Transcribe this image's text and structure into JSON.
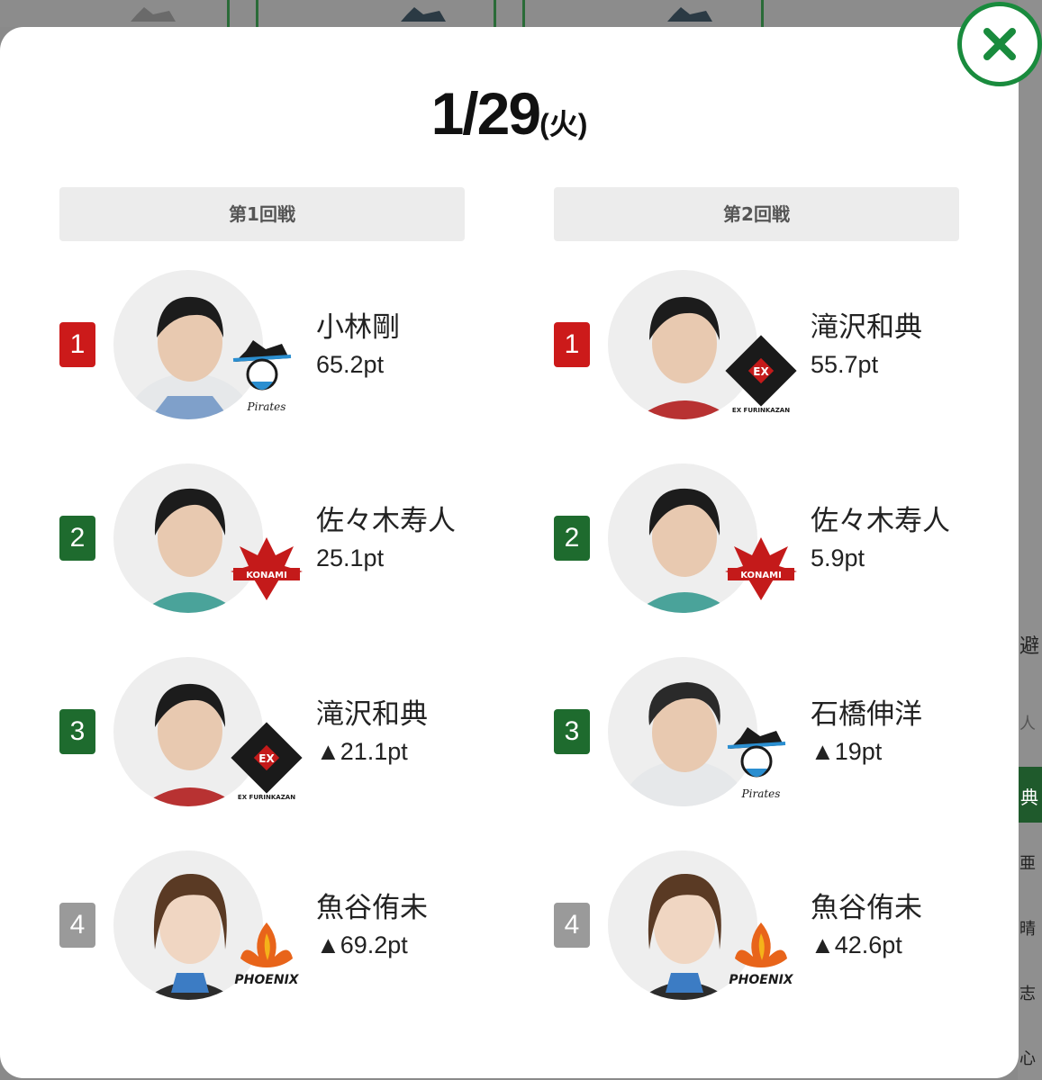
{
  "modal": {
    "date": "1/29",
    "weekday": "(火)",
    "close_icon": "close-x-icon"
  },
  "rounds": [
    {
      "label": "第1回戦",
      "results": [
        {
          "rank": "1",
          "name": "小林剛",
          "score": "65.2pt",
          "team": "pirates"
        },
        {
          "rank": "2",
          "name": "佐々木寿人",
          "score": "25.1pt",
          "team": "konami"
        },
        {
          "rank": "3",
          "name": "滝沢和典",
          "score": "▲21.1pt",
          "team": "furinkazan"
        },
        {
          "rank": "4",
          "name": "魚谷侑未",
          "score": "▲69.2pt",
          "team": "phoenix"
        }
      ]
    },
    {
      "label": "第2回戦",
      "results": [
        {
          "rank": "1",
          "name": "滝沢和典",
          "score": "55.7pt",
          "team": "furinkazan"
        },
        {
          "rank": "2",
          "name": "佐々木寿人",
          "score": "5.9pt",
          "team": "konami"
        },
        {
          "rank": "3",
          "name": "石橋伸洋",
          "score": "▲19pt",
          "team": "pirates"
        },
        {
          "rank": "4",
          "name": "魚谷侑未",
          "score": "▲42.6pt",
          "team": "phoenix"
        }
      ]
    }
  ],
  "background": {
    "side_items": [
      "避",
      "人",
      "典",
      "亜",
      "晴",
      "志",
      "心"
    ]
  },
  "colors": {
    "rank1": "#cc1a1a",
    "rank2": "#1e6b2e",
    "rank3": "#1e6b2e",
    "rank4": "#9a9a9a",
    "accent": "#198b3d"
  }
}
